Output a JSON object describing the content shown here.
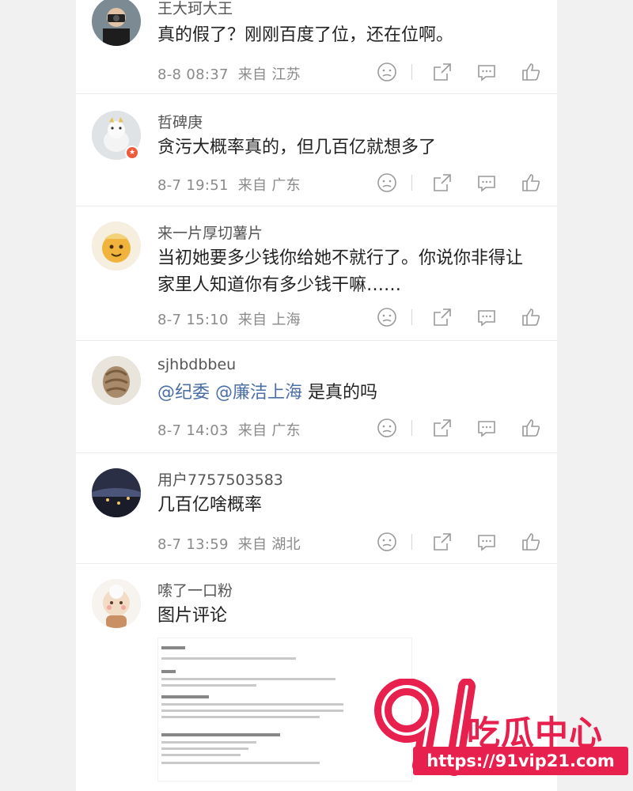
{
  "comments": [
    {
      "username": "王大珂大王",
      "text": "真的假了？刚刚百度了位，还在位啊。",
      "time": "8-8 08:37",
      "from": "来自 江苏"
    },
    {
      "username": "哲碑庚",
      "text": "贪污大概率真的，但几百亿就想多了",
      "time": "8-7 19:51",
      "from": "来自 广东"
    },
    {
      "username": "来一片厚切薯片",
      "text": "当初她要多少钱你给她不就行了。你说你非得让家里人知道你有多少钱干嘛……",
      "time": "8-7 15:10",
      "from": "来自 上海"
    },
    {
      "username": "sjhbdbbeu",
      "mention1": "@纪委",
      "mention2": "@廉洁上海",
      "text": " 是真的吗",
      "time": "8-7 14:03",
      "from": "来自 广东"
    },
    {
      "username": "用户7757503583",
      "text": "几百亿啥概率",
      "time": "8-7 13:59",
      "from": "来自 湖北"
    },
    {
      "username": "嗦了一口粉",
      "text": "图片评论",
      "time": "",
      "from": ""
    }
  ],
  "watermark": {
    "number": "91",
    "name": "吃瓜中心",
    "url": "https://91vip21.com"
  },
  "colors": {
    "accent": "#e8204e",
    "mention": "#4a6fa5",
    "badge": "#f05a3c"
  }
}
